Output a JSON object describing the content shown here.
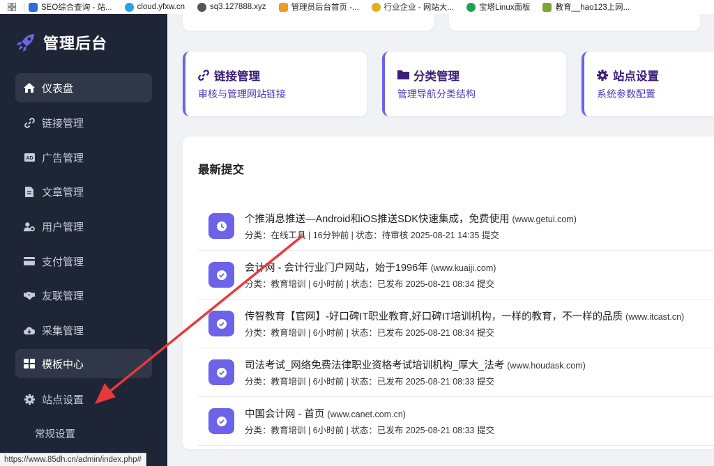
{
  "bookmarks": [
    {
      "label": "SEO综合查询 - 站...",
      "color": "#2a6fdb"
    },
    {
      "label": "cloud.yfxw.cn",
      "color": "#29a3e0"
    },
    {
      "label": "sq3.127888.xyz",
      "color": "#555555"
    },
    {
      "label": "管理员后台首页 -...",
      "color": "#e8a020"
    },
    {
      "label": "行业企业 - 网站大...",
      "color": "#e0b020"
    },
    {
      "label": "宝塔Linux面板",
      "color": "#20a050"
    },
    {
      "label": "教育__hao123上网...",
      "color": "#7aa830"
    }
  ],
  "brand": {
    "title": "管理后台"
  },
  "nav": [
    {
      "label": "仪表盘",
      "icon": "home-icon"
    },
    {
      "label": "链接管理",
      "icon": "link-icon"
    },
    {
      "label": "广告管理",
      "icon": "ad-icon"
    },
    {
      "label": "文章管理",
      "icon": "file-icon"
    },
    {
      "label": "用户管理",
      "icon": "user-gear-icon"
    },
    {
      "label": "支付管理",
      "icon": "credit-card-icon"
    },
    {
      "label": "友联管理",
      "icon": "handshake-icon"
    },
    {
      "label": "采集管理",
      "icon": "cloud-download-icon"
    },
    {
      "label": "模板中心",
      "icon": "grid-icon"
    },
    {
      "label": "站点设置",
      "icon": "gear-icon"
    }
  ],
  "nav_sub": {
    "label": "常规设置"
  },
  "status_url": "https://www.85dh.cn/admin/index.php#",
  "quick_cards": [
    {
      "title": "链接管理",
      "subtitle": "审核与管理网站链接",
      "icon": "link-icon"
    },
    {
      "title": "分类管理",
      "subtitle": "管理导航分类结构",
      "icon": "folder-icon"
    },
    {
      "title": "站点设置",
      "subtitle": "系统参数配置",
      "icon": "gear-icon"
    }
  ],
  "recent": {
    "title": "最新提交",
    "items": [
      {
        "name": "个推消息推送—Android和iOS推送SDK快速集成，免费使用",
        "domain": "(www.getui.com)",
        "meta": "分类：在线工具 | 16分钟前 | 状态：待审核 2025-08-21 14:35 提交",
        "icon": "clock-icon"
      },
      {
        "name": "会计网 - 会计行业门户网站，始于1996年",
        "domain": "(www.kuaiji.com)",
        "meta": "分类：教育培训 | 6小时前 | 状态：已发布 2025-08-21 08:34 提交",
        "icon": "check-circle-icon"
      },
      {
        "name": "传智教育【官网】-好口碑IT职业教育,好口碑IT培训机构，一样的教育，不一样的品质",
        "domain": "(www.itcast.cn)",
        "meta": "分类：教育培训 | 6小时前 | 状态：已发布 2025-08-21 08:34 提交",
        "icon": "check-circle-icon"
      },
      {
        "name": "司法考试_网络免费法律职业资格考试培训机构_厚大_法考",
        "domain": "(www.houdask.com)",
        "meta": "分类：教育培训 | 6小时前 | 状态：已发布 2025-08-21 08:33 提交",
        "icon": "check-circle-icon"
      },
      {
        "name": "中国会计网 - 首页",
        "domain": "(www.canet.com.cn)",
        "meta": "分类：教育培训 | 6小时前 | 状态：已发布 2025-08-21 08:33 提交",
        "icon": "check-circle-icon"
      }
    ]
  },
  "colors": {
    "accent": "#6c63e8",
    "sidebar": "#1e2536",
    "arrow": "#e8393a"
  }
}
